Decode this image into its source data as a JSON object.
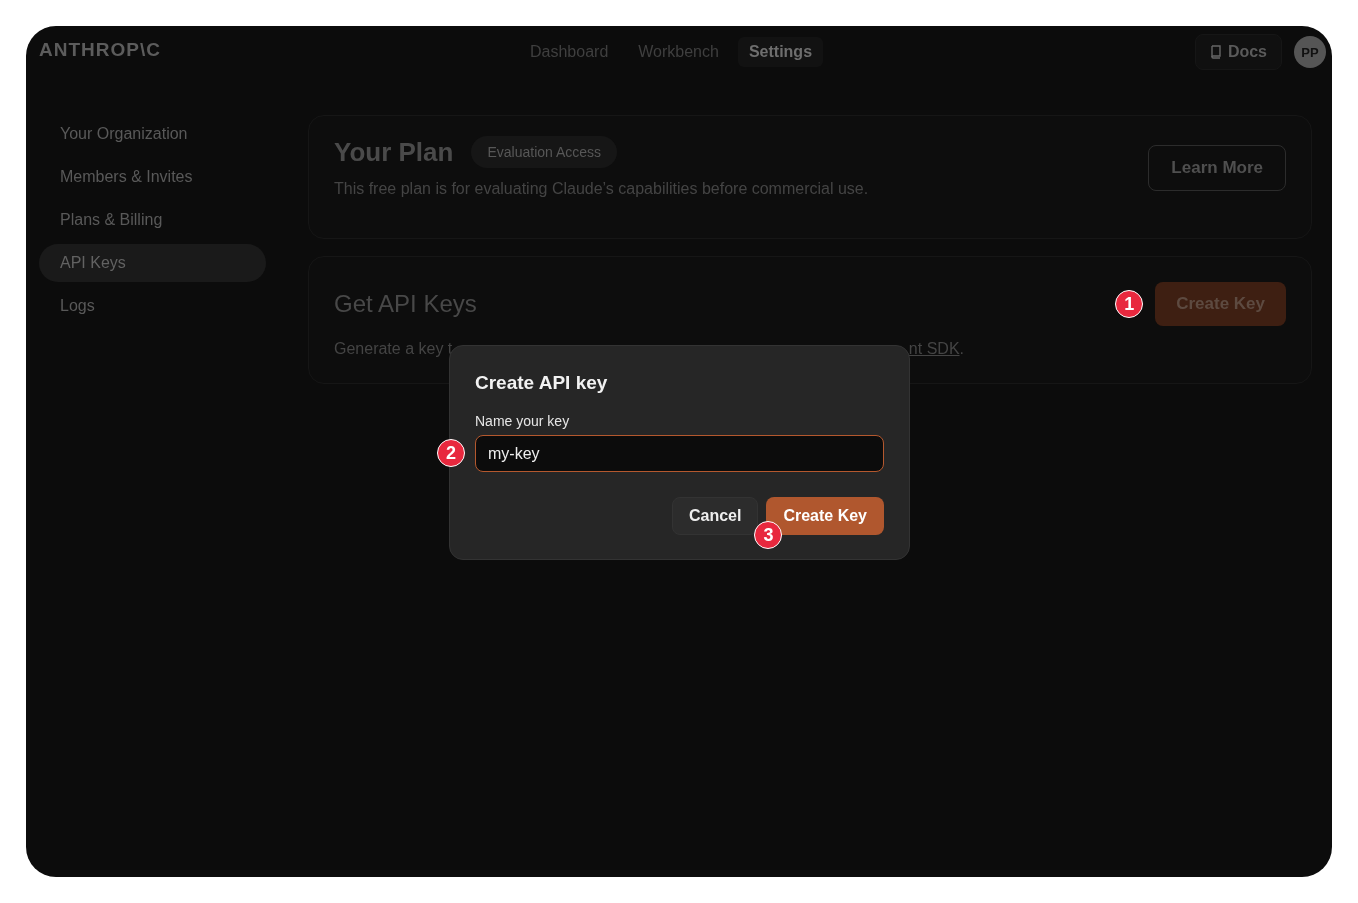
{
  "header": {
    "logo": "ANTHROP\\C",
    "nav": [
      {
        "label": "Dashboard",
        "selected": false
      },
      {
        "label": "Workbench",
        "selected": false
      },
      {
        "label": "Settings",
        "selected": true
      }
    ],
    "docs": "Docs",
    "avatar": "PP"
  },
  "sidebar": {
    "items": [
      {
        "label": "Your Organization",
        "selected": false
      },
      {
        "label": "Members & Invites",
        "selected": false
      },
      {
        "label": "Plans & Billing",
        "selected": false
      },
      {
        "label": "API Keys",
        "selected": true
      },
      {
        "label": "Logs",
        "selected": false
      }
    ]
  },
  "plan": {
    "title": "Your Plan",
    "badge": "Evaluation Access",
    "description": "This free plan is for evaluating Claude’s capabilities before commercial use.",
    "button": "Learn More"
  },
  "api_keys": {
    "title": "Get API Keys",
    "description_start": "Generate a key t",
    "description_link": "nt SDK",
    "description_end": ".",
    "button": "Create Key",
    "step": "1"
  },
  "dialog": {
    "title": "Create API key",
    "field_label": "Name your key",
    "value": "my-key",
    "cancel": "Cancel",
    "submit": "Create Key",
    "field_step": "2",
    "submit_step": "3"
  }
}
